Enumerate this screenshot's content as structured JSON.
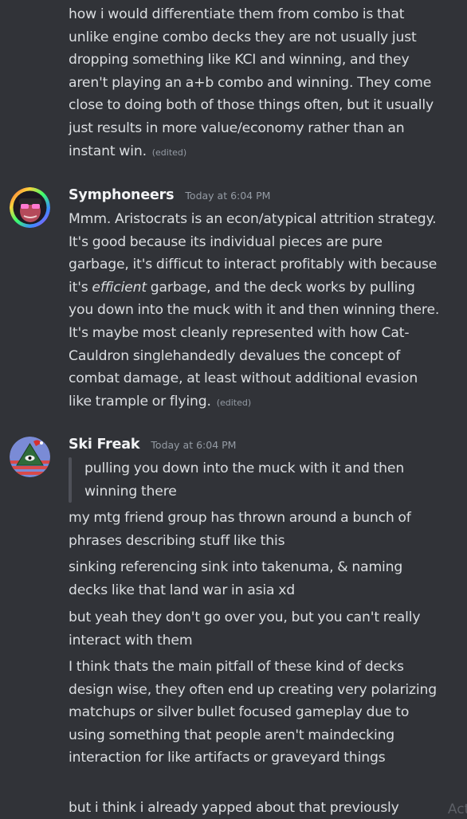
{
  "messages": {
    "first": {
      "paragraph": "how i would differentiate them from combo is that unlike engine combo decks they are not usually just dropping something like KCI and winning, and they aren't playing an a+b combo and winning. They come close to doing both of those things often, but it usually just results in more value/economy rather than an instant win.",
      "edited": "(edited)"
    },
    "symphoneers": {
      "username": "Symphoneers",
      "timestamp": "Today at 6:04 PM",
      "text_before_italic": "Mmm. Aristocrats is an econ/atypical attrition strategy. It's good because its individual pieces are pure garbage, it's difficut to interact profitably with because it's ",
      "italic": "efficient",
      "text_after_italic": " garbage, and the deck works by pulling you down into the muck with it and then winning there. It's maybe most cleanly represented with how Cat-Cauldron singlehandedly devalues the concept of combat damage, at least without additional evasion like trample or flying.",
      "edited": "(edited)"
    },
    "ski_freak": {
      "username": "Ski Freak",
      "timestamp": "Today at 6:04 PM",
      "quote": "pulling you down into the muck with it and then winning there",
      "lines": [
        "my mtg friend group has thrown around a bunch of phrases describing stuff like this",
        "sinking referencing sink into takenuma, & naming decks like that land war in asia xd",
        "but yeah they don't go over you, but you can't really interact with them",
        "I think thats the main pitfall of these kind of decks design wise, they often end up creating very polarizing matchups or silver bullet focused gameplay due to using something that people aren't maindecking interaction for like artifacts or graveyard things",
        "but i think i already yapped about that previously"
      ]
    }
  },
  "overlay": {
    "partial_text": "Acti"
  },
  "colors": {
    "background": "#313338",
    "text": "#dbdee1",
    "username": "#f2f3f5",
    "muted": "#949ba4",
    "quote_bar": "#4e5058"
  },
  "icons": {
    "symphoneers_avatar": "avatar-symphoneers-icon",
    "ski_freak_avatar": "avatar-ski-freak-icon"
  }
}
